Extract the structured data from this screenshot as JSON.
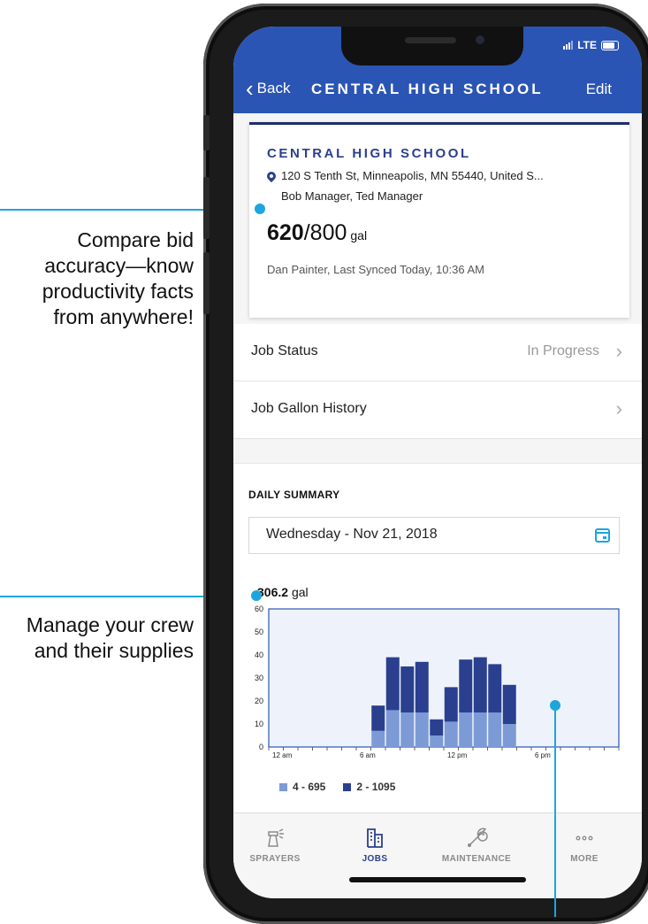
{
  "annotations": {
    "callout1": [
      "Compare bid",
      "accuracy—know",
      "productivity facts",
      "from anywhere!"
    ],
    "callout2": [
      "Manage your crew",
      "and their supplies"
    ]
  },
  "status_bar": {
    "network": "LTE"
  },
  "nav": {
    "back": "Back",
    "title": "CENTRAL HIGH SCHOOL",
    "edit": "Edit"
  },
  "job": {
    "name": "CENTRAL HIGH SCHOOL",
    "address": "120 S Tenth St, Minneapolis, MN 55440, United S...",
    "managers": "Bob Manager, Ted Manager",
    "gallons_used": "620",
    "gallons_total": "/800",
    "unit": "gal",
    "sync": "Dan Painter, Last Synced Today, 10:36 AM"
  },
  "rows": {
    "status_label": "Job Status",
    "status_value": "In Progress",
    "history_label": "Job Gallon History"
  },
  "summary": {
    "header": "DAILY SUMMARY",
    "date": "Wednesday - Nov 21, 2018",
    "total_value": "306.2",
    "total_unit": "gal"
  },
  "chart_data": {
    "type": "bar",
    "stacked": true,
    "ylim": [
      0,
      60
    ],
    "yticks": [
      "60",
      "50",
      "40",
      "30",
      "20",
      "10",
      "0"
    ],
    "xtick_labels": [
      {
        "hour": 0,
        "label": "12 am"
      },
      {
        "hour": 6,
        "label": "6 am"
      },
      {
        "hour": 12,
        "label": "12 pm"
      },
      {
        "hour": 18,
        "label": "6 pm"
      }
    ],
    "hours": [
      7,
      8,
      9,
      10,
      11,
      12,
      13,
      14,
      15,
      16,
      17
    ],
    "series": [
      {
        "name": "4 - 695",
        "color": "#7c9ad6",
        "values": [
          7,
          16,
          15,
          15,
          5,
          11,
          15,
          15,
          15,
          10,
          0
        ]
      },
      {
        "name": "2 - 1095",
        "color": "#2b3f8f",
        "values": [
          11,
          23,
          20,
          22,
          7,
          15,
          23,
          24,
          21,
          17,
          0
        ]
      }
    ],
    "grid": false,
    "legend_position": "bottom-left"
  },
  "tabs": [
    {
      "label": "SPRAYERS",
      "icon": "sprayer-icon",
      "active": false
    },
    {
      "label": "JOBS",
      "icon": "jobs-icon",
      "active": true
    },
    {
      "label": "MAINTENANCE",
      "icon": "wrench-icon",
      "active": false
    },
    {
      "label": "MORE",
      "icon": "more-icon",
      "active": false
    }
  ]
}
